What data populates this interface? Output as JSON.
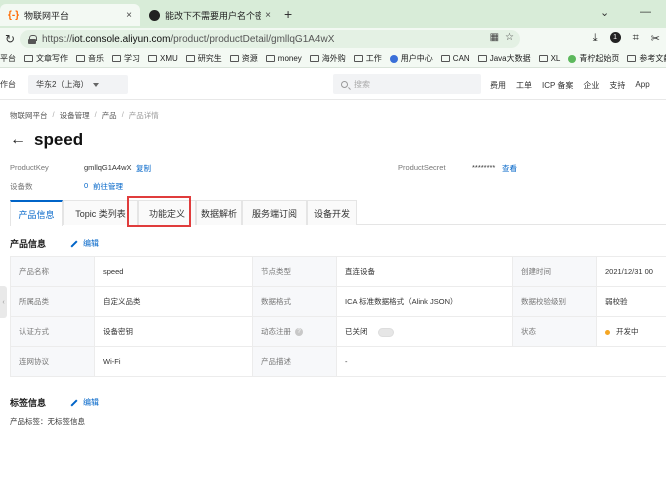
{
  "browser": {
    "tabs": [
      {
        "title": "物联网平台",
        "icon": "aliyun-icon"
      },
      {
        "title": "能改下不需要用户名个密码也可以",
        "icon": "github-icon"
      }
    ],
    "close_glyph": "×",
    "new_tab_glyph": "+",
    "window_controls": {
      "collapse": "⌄",
      "minimize": "—"
    },
    "url_prefix": "https://",
    "url_host": "iot.console.aliyun.com",
    "url_path": "/product/productDetail/gmllqG1A4wX",
    "toolbar_badge": "1",
    "bookmarks": [
      "平台",
      "文章写作",
      "音乐",
      "学习",
      "XMU",
      "研究生",
      "资源",
      "money",
      "海外购",
      "工作",
      "用户中心",
      "CAN",
      "Java大数据",
      "XL",
      "青柠起始页",
      "参考文献"
    ]
  },
  "console": {
    "left_label": "作台",
    "region": "华东2（上海）",
    "search_placeholder": "搜索",
    "links": [
      "费用",
      "工单",
      "ICP 备案",
      "企业",
      "支持",
      "App"
    ]
  },
  "breadcrumb": [
    "物联网平台",
    "设备管理",
    "产品",
    "产品详情"
  ],
  "breadcrumb_sep": "/",
  "page": {
    "title": "speed",
    "back_glyph": "←",
    "productkey_label": "ProductKey",
    "productkey_value": "gmllqG1A4wX",
    "copy_label": "复制",
    "device_count_label": "设备数",
    "device_count_value": "0",
    "manage_link": "前往管理",
    "productsecret_label": "ProductSecret",
    "productsecret_value": "********",
    "view_link": "查看"
  },
  "tabs": [
    "产品信息",
    "Topic 类列表",
    "功能定义",
    "数据解析",
    "服务端订阅",
    "设备开发"
  ],
  "product_info": {
    "section_title": "产品信息",
    "edit_label": "编辑",
    "rows": [
      [
        "产品名称",
        "speed",
        "节点类型",
        "直连设备",
        "创建时间",
        "2021/12/31 00"
      ],
      [
        "所属品类",
        "自定义品类",
        "数据格式",
        "ICA 标准数据格式（Alink JSON）",
        "数据校验级别",
        "弱校验"
      ],
      [
        "认证方式",
        "设备密钥",
        "动态注册",
        "已关闭",
        "状态",
        "开发中"
      ],
      [
        "连网协议",
        "Wi-Fi",
        "产品描述",
        "-",
        "",
        ""
      ]
    ],
    "help_glyph": "?",
    "status_color": "#f5a623"
  },
  "tag_info": {
    "section_title": "标签信息",
    "edit_label": "编辑",
    "tag_label": "产品标签：",
    "tag_value": "无标签信息"
  },
  "side_handle_glyph": "‹",
  "colors": {
    "accent": "#0064c8",
    "highlight": "#e03c3c",
    "brand": "#ff6a00"
  }
}
